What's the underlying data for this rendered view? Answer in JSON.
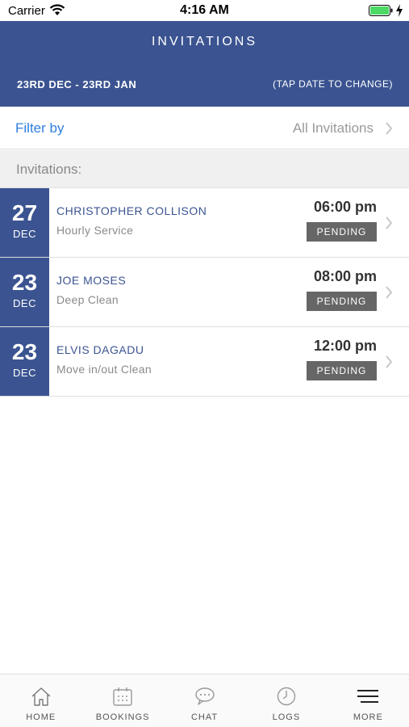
{
  "status_bar": {
    "carrier": "Carrier",
    "time": "4:16 AM",
    "battery_color": "#4cd964"
  },
  "header": {
    "title": "INVITATIONS",
    "date_range": "23RD DEC - 23RD JAN",
    "tap_hint": "(TAP DATE TO CHANGE)",
    "background_color": "#3b5491"
  },
  "filter": {
    "label": "Filter by",
    "value": "All Invitations"
  },
  "section": {
    "title": "Invitations:"
  },
  "invitations": [
    {
      "day": "27",
      "month": "DEC",
      "name": "CHRISTOPHER COLLISON",
      "service": "Hourly Service",
      "time": "06:00 pm",
      "status": "PENDING"
    },
    {
      "day": "23",
      "month": "DEC",
      "name": "JOE MOSES",
      "service": "Deep Clean",
      "time": "08:00 pm",
      "status": "PENDING"
    },
    {
      "day": "23",
      "month": "DEC",
      "name": "ELVIS DAGADU",
      "service": "Move in/out Clean",
      "time": "12:00 pm",
      "status": "PENDING"
    }
  ],
  "tabs": [
    {
      "label": "HOME",
      "icon": "home-icon"
    },
    {
      "label": "BOOKINGS",
      "icon": "calendar-icon"
    },
    {
      "label": "CHAT",
      "icon": "chat-icon"
    },
    {
      "label": "LOGS",
      "icon": "clock-icon"
    },
    {
      "label": "MORE",
      "icon": "menu-icon"
    }
  ]
}
